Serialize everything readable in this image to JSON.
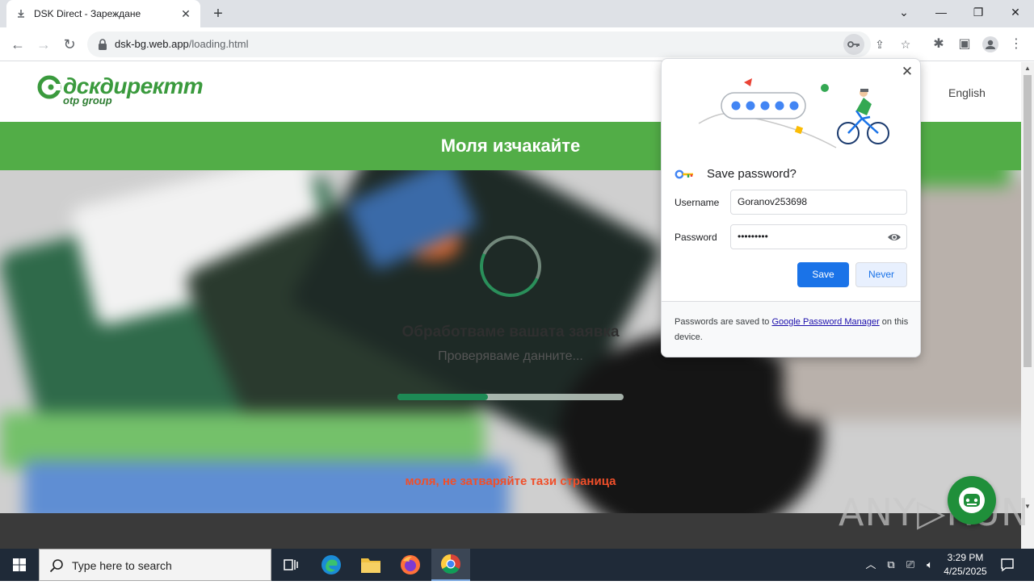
{
  "browser": {
    "tab_title": "DSK Direct - Зареждане",
    "url_host": "dsk-bg.web.app",
    "url_path": "/loading.html"
  },
  "site": {
    "logo_text": "дскдиректт",
    "logo_sub": "otp group",
    "lang_link": "English",
    "banner_text": "Моля изчакайте",
    "processing_title": "Обработваме вашата заявка",
    "processing_sub": "Проверяваме данните...",
    "progress_fraction": 0.4,
    "warning_text": "моля, не затваряйте тази страница"
  },
  "password_popup": {
    "title": "Save password?",
    "username_label": "Username",
    "username_value": "Goranov253698",
    "password_label": "Password",
    "password_value": "•••••••••",
    "save_label": "Save",
    "never_label": "Never",
    "footer_prefix": "Passwords are saved to ",
    "footer_link": "Google Password Manager",
    "footer_suffix": " on this device."
  },
  "watermark": "ANY▷RUN",
  "taskbar": {
    "search_placeholder": "Type here to search",
    "time": "3:29 PM",
    "date": "4/25/2025"
  },
  "colors": {
    "brand_green": "#52ad47",
    "chrome_blue": "#1a73e8",
    "warning_orange": "#f04f2a"
  }
}
